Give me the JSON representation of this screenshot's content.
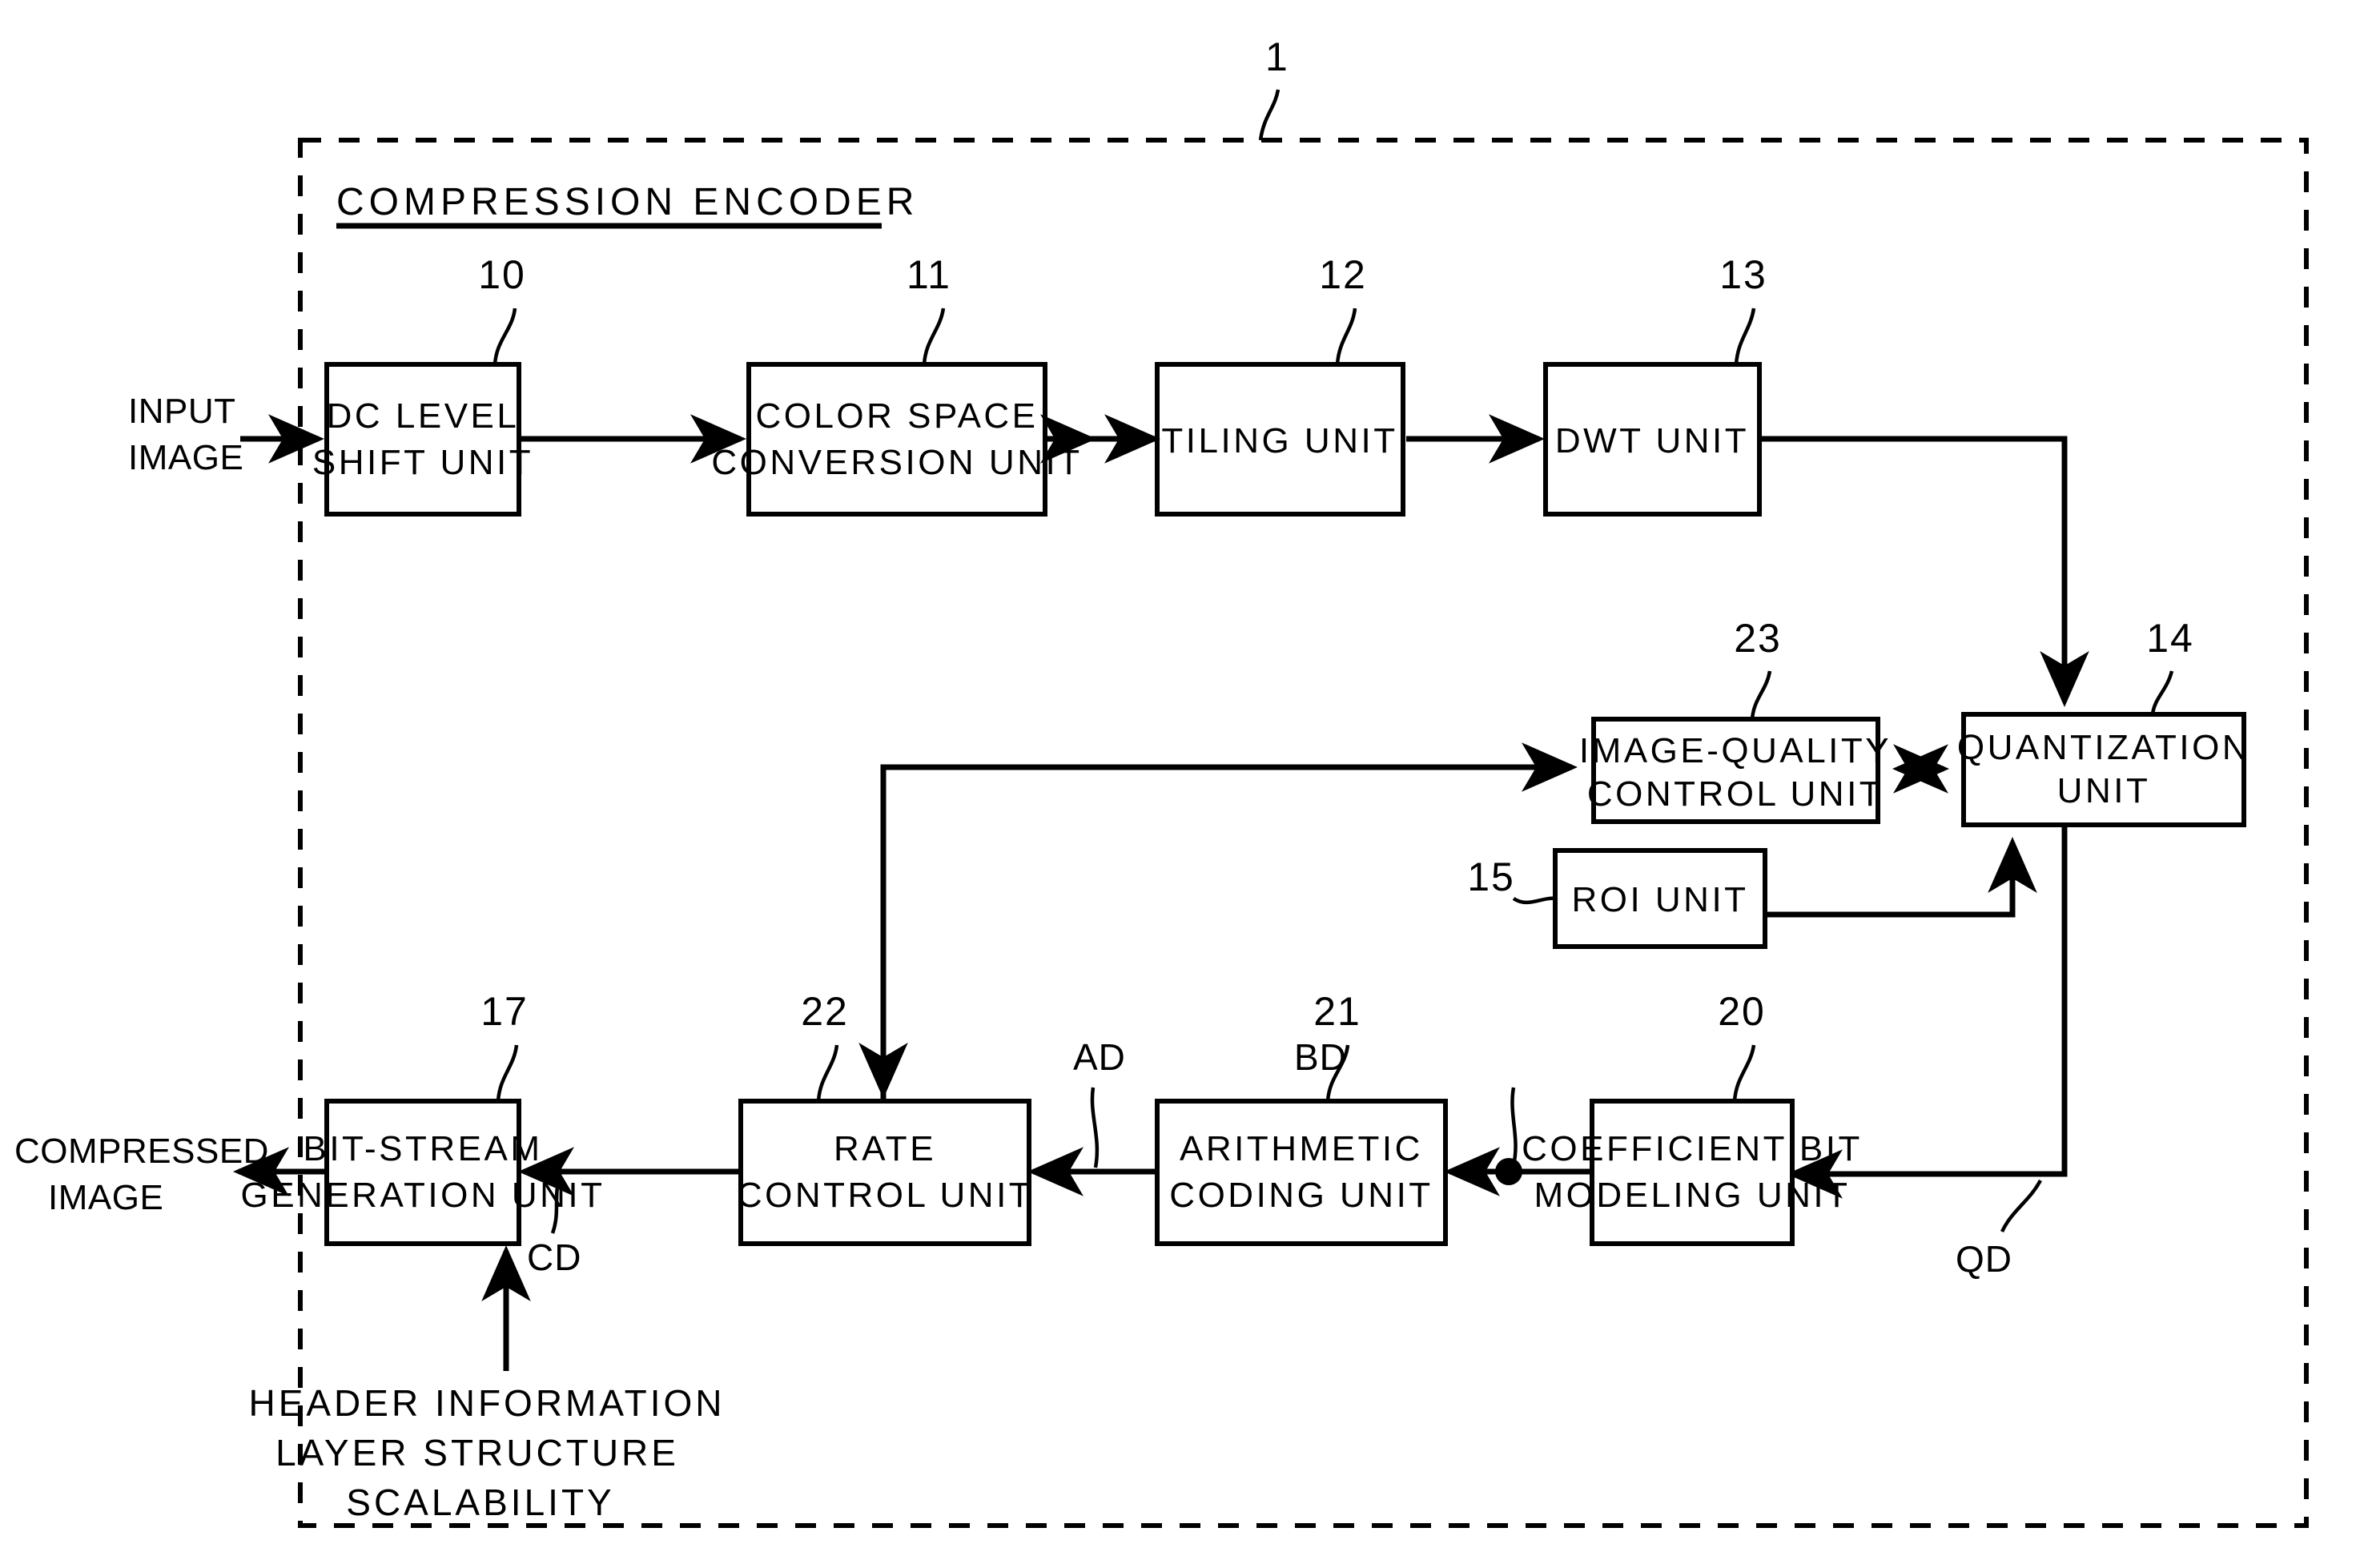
{
  "figure": {
    "top_reference_number": "1",
    "container_title": "COMPRESSION ENCODER"
  },
  "io": {
    "input_line1": "INPUT",
    "input_line2": "IMAGE",
    "output_line1": "COMPRESSED",
    "output_line2": "IMAGE"
  },
  "blocks": {
    "dc_level_shift": {
      "ref": "10",
      "line1": "DC LEVEL",
      "line2": "SHIFT UNIT"
    },
    "color_space_conversion": {
      "ref": "11",
      "line1": "COLOR SPACE",
      "line2": "CONVERSION UNIT"
    },
    "tiling": {
      "ref": "12",
      "line1": "TILING UNIT",
      "line2": ""
    },
    "dwt": {
      "ref": "13",
      "line1": "DWT UNIT",
      "line2": ""
    },
    "image_quality_control": {
      "ref": "23",
      "line1": "IMAGE-QUALITY",
      "line2": "CONTROL UNIT"
    },
    "quantization": {
      "ref": "14",
      "line1": "QUANTIZATION",
      "line2": "UNIT"
    },
    "roi": {
      "ref": "15",
      "line1": "ROI UNIT",
      "line2": ""
    },
    "bit_stream_generation": {
      "ref": "17",
      "line1": "BIT-STREAM",
      "line2": "GENERATION UNIT"
    },
    "rate_control": {
      "ref": "22",
      "line1": "RATE",
      "line2": "CONTROL UNIT"
    },
    "arithmetic_coding": {
      "ref": "21",
      "line1": "ARITHMETIC",
      "line2": "CODING UNIT"
    },
    "coefficient_bit_modeling": {
      "ref": "20",
      "line1": "COEFFICIENT BIT",
      "line2": "MODELING UNIT"
    }
  },
  "signals": {
    "ad": "AD",
    "bd": "BD",
    "cd": "CD",
    "qd": "QD"
  },
  "notes": {
    "line1": "HEADER INFORMATION",
    "line2": "LAYER STRUCTURE",
    "line3": "SCALABILITY"
  },
  "colors": {
    "ink": "#000000",
    "paper": "#ffffff"
  }
}
